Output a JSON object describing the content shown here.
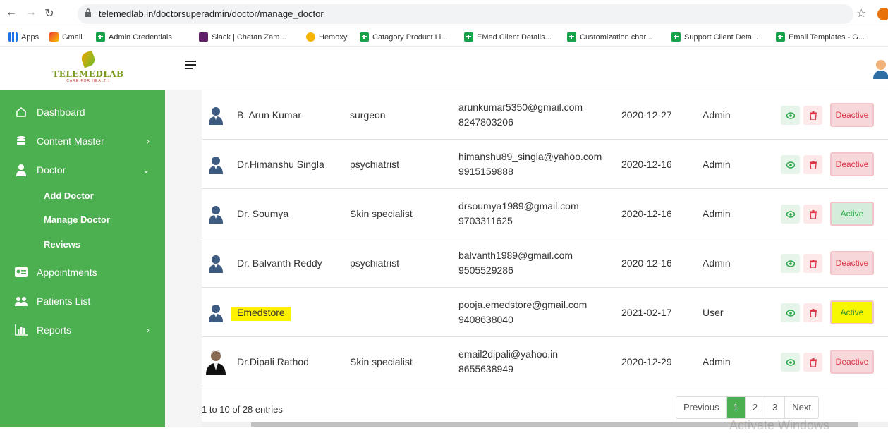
{
  "browser": {
    "url": "telemedlab.in/doctorsuperadmin/doctor/manage_doctor",
    "bookmarks": [
      {
        "label": "Apps",
        "icon": "apps-grid-icon"
      },
      {
        "label": "Gmail",
        "icon": "gmail-icon"
      },
      {
        "label": "Admin Credentials",
        "icon": "sheets-icon"
      },
      {
        "label": "Slack | Chetan Zam...",
        "icon": "slack-icon"
      },
      {
        "label": "Hemoxy",
        "icon": "hemoxy-icon"
      },
      {
        "label": "Catagory Product Li...",
        "icon": "sheets-icon"
      },
      {
        "label": "EMed Client Details...",
        "icon": "sheets-icon"
      },
      {
        "label": "Customization char...",
        "icon": "sheets-icon"
      },
      {
        "label": "Support Client Deta...",
        "icon": "sheets-icon"
      },
      {
        "label": "Email Templates - G...",
        "icon": "sheets-icon"
      }
    ]
  },
  "logo": {
    "name": "TELEMEDLAB",
    "tagline": "CARE FOR HEALTH"
  },
  "sidebar": {
    "items": [
      {
        "label": "Dashboard",
        "icon": "home-icon"
      },
      {
        "label": "Content Master",
        "icon": "database-icon"
      },
      {
        "label": "Doctor",
        "icon": "doctor-icon"
      },
      {
        "label": "Appointments",
        "icon": "id-card-icon"
      },
      {
        "label": "Patients List",
        "icon": "users-icon"
      },
      {
        "label": "Reports",
        "icon": "bar-chart-icon"
      }
    ],
    "doctor_sub": [
      "Add Doctor",
      "Manage Doctor",
      "Reviews"
    ]
  },
  "doctors": [
    {
      "name": "B. Arun Kumar",
      "specialization": "surgeon",
      "email": "arunkumar5350@gmail.com",
      "phone": "8247803206",
      "date": "2020-12-27",
      "role": "Admin",
      "status": "Deactive"
    },
    {
      "name": "Dr.Himanshu Singla",
      "specialization": "psychiatrist",
      "email": "himanshu89_singla@yahoo.com",
      "phone": "9915159888",
      "date": "2020-12-16",
      "role": "Admin",
      "status": "Deactive"
    },
    {
      "name": "Dr. Soumya",
      "specialization": "Skin specialist",
      "email": "drsoumya1989@gmail.com",
      "phone": "9703311625",
      "date": "2020-12-16",
      "role": "Admin",
      "status": "Active"
    },
    {
      "name": "Dr. Balvanth Reddy",
      "specialization": "psychiatrist",
      "email": "balvanth1989@gmail.com",
      "phone": "9505529286",
      "date": "2020-12-16",
      "role": "Admin",
      "status": "Deactive"
    },
    {
      "name": "Emedstore",
      "specialization": "",
      "email": "pooja.emedstore@gmail.com",
      "phone": "9408638040",
      "date": "2021-02-17",
      "role": "User",
      "status": "Active"
    },
    {
      "name": "Dr.Dipali Rathod",
      "specialization": "Skin specialist",
      "email": "email2dipali@yahoo.in",
      "phone": "8655638949",
      "date": "2020-12-29",
      "role": "Admin",
      "status": "Deactive"
    }
  ],
  "entries_text": "1 to 10 of 28 entries",
  "pagination": {
    "previous": "Previous",
    "pages": [
      "1",
      "2",
      "3"
    ],
    "next": "Next"
  },
  "watermark": "Activate Windows",
  "colors": {
    "sidebar": "#4caf50",
    "active": "#28a745",
    "deactive": "#dc3545",
    "highlight": "#fff200"
  }
}
